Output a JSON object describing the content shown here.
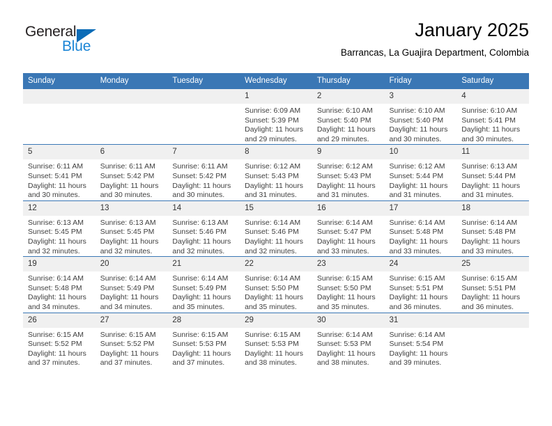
{
  "brand": {
    "name_top": "General",
    "name_bottom": "Blue",
    "color_dark": "#231f20",
    "color_blue": "#1b85d6",
    "triangle_color": "#0b6cb7"
  },
  "header": {
    "title": "January 2025",
    "subtitle": "Barrancas, La Guajira Department, Colombia"
  },
  "theme": {
    "header_bg": "#3a77b5",
    "header_text": "#ffffff",
    "daynum_bg": "#f0f0f0",
    "cell_bg": "#ffffff",
    "body_text": "#3f3f3f"
  },
  "weekdays": [
    "Sunday",
    "Monday",
    "Tuesday",
    "Wednesday",
    "Thursday",
    "Friday",
    "Saturday"
  ],
  "labels": {
    "sunrise_prefix": "Sunrise: ",
    "sunset_prefix": "Sunset: ",
    "daylight_prefix": "Daylight: "
  },
  "weeks": [
    [
      {
        "day": "",
        "empty": true
      },
      {
        "day": "",
        "empty": true
      },
      {
        "day": "",
        "empty": true
      },
      {
        "day": "1",
        "sunrise": "Sunrise: 6:09 AM",
        "sunset": "Sunset: 5:39 PM",
        "daylight_1": "Daylight: 11 hours",
        "daylight_2": "and 29 minutes."
      },
      {
        "day": "2",
        "sunrise": "Sunrise: 6:10 AM",
        "sunset": "Sunset: 5:40 PM",
        "daylight_1": "Daylight: 11 hours",
        "daylight_2": "and 29 minutes."
      },
      {
        "day": "3",
        "sunrise": "Sunrise: 6:10 AM",
        "sunset": "Sunset: 5:40 PM",
        "daylight_1": "Daylight: 11 hours",
        "daylight_2": "and 30 minutes."
      },
      {
        "day": "4",
        "sunrise": "Sunrise: 6:10 AM",
        "sunset": "Sunset: 5:41 PM",
        "daylight_1": "Daylight: 11 hours",
        "daylight_2": "and 30 minutes."
      }
    ],
    [
      {
        "day": "5",
        "sunrise": "Sunrise: 6:11 AM",
        "sunset": "Sunset: 5:41 PM",
        "daylight_1": "Daylight: 11 hours",
        "daylight_2": "and 30 minutes."
      },
      {
        "day": "6",
        "sunrise": "Sunrise: 6:11 AM",
        "sunset": "Sunset: 5:42 PM",
        "daylight_1": "Daylight: 11 hours",
        "daylight_2": "and 30 minutes."
      },
      {
        "day": "7",
        "sunrise": "Sunrise: 6:11 AM",
        "sunset": "Sunset: 5:42 PM",
        "daylight_1": "Daylight: 11 hours",
        "daylight_2": "and 30 minutes."
      },
      {
        "day": "8",
        "sunrise": "Sunrise: 6:12 AM",
        "sunset": "Sunset: 5:43 PM",
        "daylight_1": "Daylight: 11 hours",
        "daylight_2": "and 31 minutes."
      },
      {
        "day": "9",
        "sunrise": "Sunrise: 6:12 AM",
        "sunset": "Sunset: 5:43 PM",
        "daylight_1": "Daylight: 11 hours",
        "daylight_2": "and 31 minutes."
      },
      {
        "day": "10",
        "sunrise": "Sunrise: 6:12 AM",
        "sunset": "Sunset: 5:44 PM",
        "daylight_1": "Daylight: 11 hours",
        "daylight_2": "and 31 minutes."
      },
      {
        "day": "11",
        "sunrise": "Sunrise: 6:13 AM",
        "sunset": "Sunset: 5:44 PM",
        "daylight_1": "Daylight: 11 hours",
        "daylight_2": "and 31 minutes."
      }
    ],
    [
      {
        "day": "12",
        "sunrise": "Sunrise: 6:13 AM",
        "sunset": "Sunset: 5:45 PM",
        "daylight_1": "Daylight: 11 hours",
        "daylight_2": "and 32 minutes."
      },
      {
        "day": "13",
        "sunrise": "Sunrise: 6:13 AM",
        "sunset": "Sunset: 5:45 PM",
        "daylight_1": "Daylight: 11 hours",
        "daylight_2": "and 32 minutes."
      },
      {
        "day": "14",
        "sunrise": "Sunrise: 6:13 AM",
        "sunset": "Sunset: 5:46 PM",
        "daylight_1": "Daylight: 11 hours",
        "daylight_2": "and 32 minutes."
      },
      {
        "day": "15",
        "sunrise": "Sunrise: 6:14 AM",
        "sunset": "Sunset: 5:46 PM",
        "daylight_1": "Daylight: 11 hours",
        "daylight_2": "and 32 minutes."
      },
      {
        "day": "16",
        "sunrise": "Sunrise: 6:14 AM",
        "sunset": "Sunset: 5:47 PM",
        "daylight_1": "Daylight: 11 hours",
        "daylight_2": "and 33 minutes."
      },
      {
        "day": "17",
        "sunrise": "Sunrise: 6:14 AM",
        "sunset": "Sunset: 5:48 PM",
        "daylight_1": "Daylight: 11 hours",
        "daylight_2": "and 33 minutes."
      },
      {
        "day": "18",
        "sunrise": "Sunrise: 6:14 AM",
        "sunset": "Sunset: 5:48 PM",
        "daylight_1": "Daylight: 11 hours",
        "daylight_2": "and 33 minutes."
      }
    ],
    [
      {
        "day": "19",
        "sunrise": "Sunrise: 6:14 AM",
        "sunset": "Sunset: 5:48 PM",
        "daylight_1": "Daylight: 11 hours",
        "daylight_2": "and 34 minutes."
      },
      {
        "day": "20",
        "sunrise": "Sunrise: 6:14 AM",
        "sunset": "Sunset: 5:49 PM",
        "daylight_1": "Daylight: 11 hours",
        "daylight_2": "and 34 minutes."
      },
      {
        "day": "21",
        "sunrise": "Sunrise: 6:14 AM",
        "sunset": "Sunset: 5:49 PM",
        "daylight_1": "Daylight: 11 hours",
        "daylight_2": "and 35 minutes."
      },
      {
        "day": "22",
        "sunrise": "Sunrise: 6:14 AM",
        "sunset": "Sunset: 5:50 PM",
        "daylight_1": "Daylight: 11 hours",
        "daylight_2": "and 35 minutes."
      },
      {
        "day": "23",
        "sunrise": "Sunrise: 6:15 AM",
        "sunset": "Sunset: 5:50 PM",
        "daylight_1": "Daylight: 11 hours",
        "daylight_2": "and 35 minutes."
      },
      {
        "day": "24",
        "sunrise": "Sunrise: 6:15 AM",
        "sunset": "Sunset: 5:51 PM",
        "daylight_1": "Daylight: 11 hours",
        "daylight_2": "and 36 minutes."
      },
      {
        "day": "25",
        "sunrise": "Sunrise: 6:15 AM",
        "sunset": "Sunset: 5:51 PM",
        "daylight_1": "Daylight: 11 hours",
        "daylight_2": "and 36 minutes."
      }
    ],
    [
      {
        "day": "26",
        "sunrise": "Sunrise: 6:15 AM",
        "sunset": "Sunset: 5:52 PM",
        "daylight_1": "Daylight: 11 hours",
        "daylight_2": "and 37 minutes."
      },
      {
        "day": "27",
        "sunrise": "Sunrise: 6:15 AM",
        "sunset": "Sunset: 5:52 PM",
        "daylight_1": "Daylight: 11 hours",
        "daylight_2": "and 37 minutes."
      },
      {
        "day": "28",
        "sunrise": "Sunrise: 6:15 AM",
        "sunset": "Sunset: 5:53 PM",
        "daylight_1": "Daylight: 11 hours",
        "daylight_2": "and 37 minutes."
      },
      {
        "day": "29",
        "sunrise": "Sunrise: 6:15 AM",
        "sunset": "Sunset: 5:53 PM",
        "daylight_1": "Daylight: 11 hours",
        "daylight_2": "and 38 minutes."
      },
      {
        "day": "30",
        "sunrise": "Sunrise: 6:14 AM",
        "sunset": "Sunset: 5:53 PM",
        "daylight_1": "Daylight: 11 hours",
        "daylight_2": "and 38 minutes."
      },
      {
        "day": "31",
        "sunrise": "Sunrise: 6:14 AM",
        "sunset": "Sunset: 5:54 PM",
        "daylight_1": "Daylight: 11 hours",
        "daylight_2": "and 39 minutes."
      },
      {
        "day": "",
        "empty": true
      }
    ]
  ]
}
